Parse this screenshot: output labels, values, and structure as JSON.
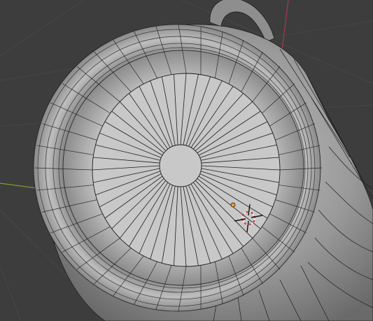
{
  "viewport": {
    "kind": "3d-viewport",
    "mode": "wireframe-overlay-edit",
    "colors": {
      "background": "#3d3d3d",
      "grid_line": "#474747",
      "x_axis": "#a33b4c",
      "y_axis": "#7a9c2e",
      "mesh_fill": "#aeaeae",
      "mesh_edges": "#1e1e1e",
      "inner_floor": "#c8c8c8",
      "origin_dot": "#f29a2a",
      "cursor_ring": "#e8e8e8",
      "cursor_ring_alt": "#d23c3c"
    },
    "icons": {
      "origin": "object-origin-icon",
      "cursor": "3d-cursor-icon"
    },
    "object": {
      "type": "mug",
      "floor_segments": 48,
      "wall_segments": 40,
      "rim_rings": 4
    }
  }
}
